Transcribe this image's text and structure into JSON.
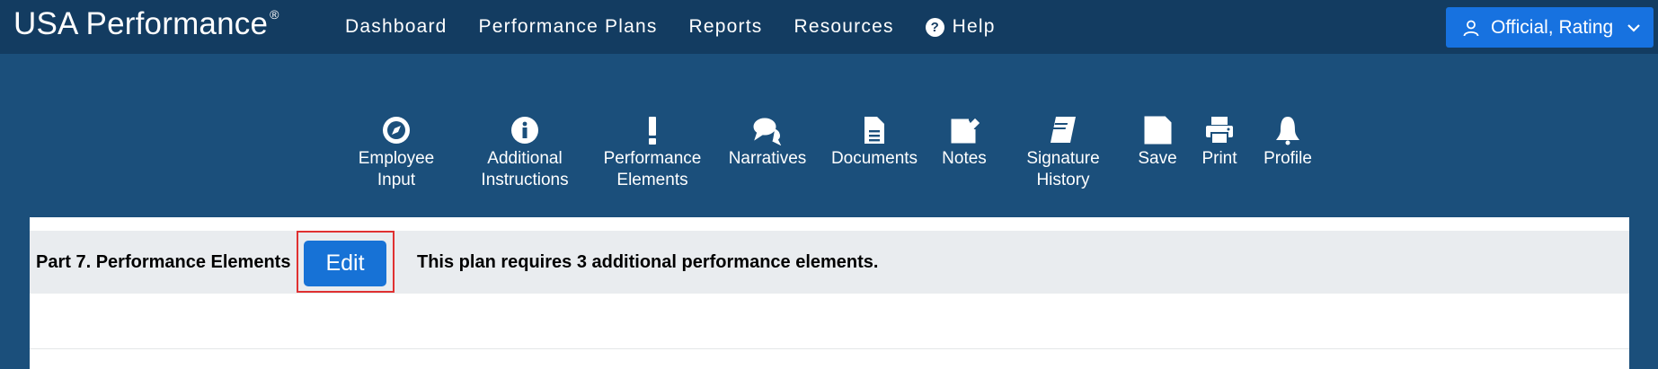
{
  "header": {
    "brand": "USA Performance",
    "brand_mark": "®",
    "nav": [
      {
        "label": "Dashboard"
      },
      {
        "label": "Performance Plans"
      },
      {
        "label": "Reports"
      },
      {
        "label": "Resources"
      },
      {
        "label": "Help",
        "icon": "question-circle-icon"
      }
    ],
    "user_menu": {
      "label": "Official, Rating",
      "icon": "user-icon"
    }
  },
  "toolbar": {
    "items": [
      {
        "label": "Employee\nInput",
        "icon": "compass-icon"
      },
      {
        "label": "Additional\nInstructions",
        "icon": "info-circle-icon"
      },
      {
        "label": "Performance\nElements",
        "icon": "exclamation-icon"
      },
      {
        "label": "Narratives",
        "icon": "comments-icon"
      },
      {
        "label": "Documents",
        "icon": "file-icon"
      },
      {
        "label": "Notes",
        "icon": "edit-icon"
      },
      {
        "label": "Signature\nHistory",
        "icon": "book-icon"
      },
      {
        "label": "Save",
        "icon": "floppy-disk-icon"
      },
      {
        "label": "Print",
        "icon": "printer-icon"
      },
      {
        "label": "Profile",
        "icon": "bell-icon"
      }
    ]
  },
  "section": {
    "title": "Part 7. Performance Elements",
    "edit_label": "Edit",
    "message": "This plan requires 3 additional performance elements."
  },
  "colors": {
    "topbar": "#133c61",
    "background": "#1b4f7b",
    "accent": "#1772e0",
    "highlight_outline": "#e03131"
  }
}
